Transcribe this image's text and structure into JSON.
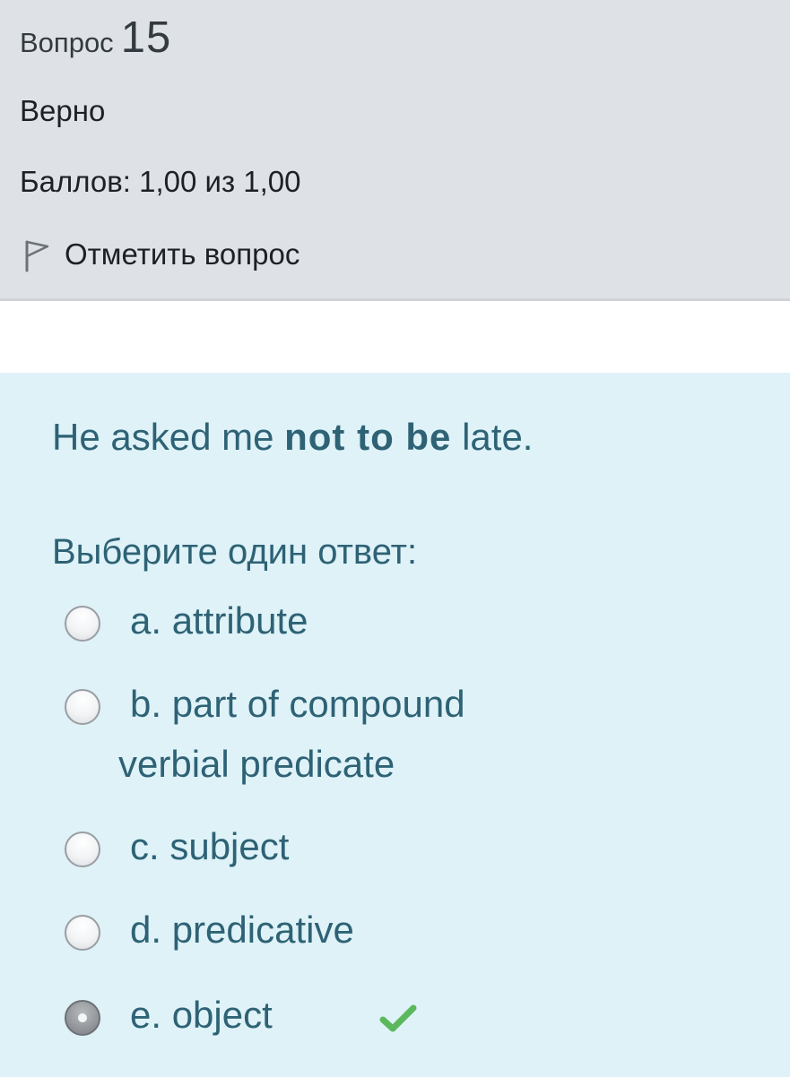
{
  "info": {
    "question_word": "Вопрос",
    "question_number": "15",
    "state": "Верно",
    "grade": "Баллов: 1,00 из 1,00",
    "flag_label": "Отметить вопрос",
    "flag_icon": "flag-outline-icon"
  },
  "question": {
    "text_before": "He asked me ",
    "text_bold": "not to be",
    "text_after": " late.",
    "prompt": "Выберите один ответ:",
    "options": [
      {
        "label": "a. attribute",
        "checked": false
      },
      {
        "label_line1": "b. part of compound",
        "label_line2": "verbial predicate",
        "checked": false
      },
      {
        "label": "c. subject",
        "checked": false
      },
      {
        "label": "d. predicative",
        "checked": false
      },
      {
        "label": "e. object",
        "checked": true,
        "correct": true
      }
    ],
    "correct_icon": "checkmark-icon",
    "correct_icon_color": "#5cb85c"
  },
  "colors": {
    "info_background": "#dee2e6",
    "content_background": "#def2f8",
    "content_text": "#2e6275"
  }
}
